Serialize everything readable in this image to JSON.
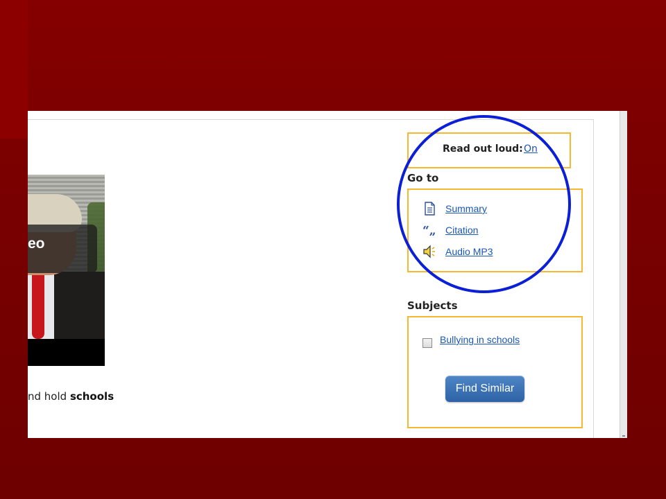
{
  "read_out_loud": {
    "label": "Read out loud:",
    "link": "On"
  },
  "goto": {
    "heading": "Go to",
    "links": [
      {
        "label": "Summary",
        "icon": "document-icon"
      },
      {
        "label": "Citation",
        "icon": "quote-icon"
      },
      {
        "label": "Audio MP3",
        "icon": "speaker-icon"
      }
    ]
  },
  "subjects": {
    "heading": "Subjects",
    "items": [
      {
        "label": "Bullying in schools",
        "checked": false
      }
    ],
    "button": "Find Similar"
  },
  "video": {
    "overlay_text": "eo"
  },
  "snippet": {
    "prefix": "nd hold ",
    "bold": "schools"
  },
  "colors": {
    "slide_background": "#7a0000",
    "box_border": "#f7b731",
    "link": "#1a57b5",
    "highlight_circle": "#0a1fd6",
    "button": "#3a72b8"
  }
}
